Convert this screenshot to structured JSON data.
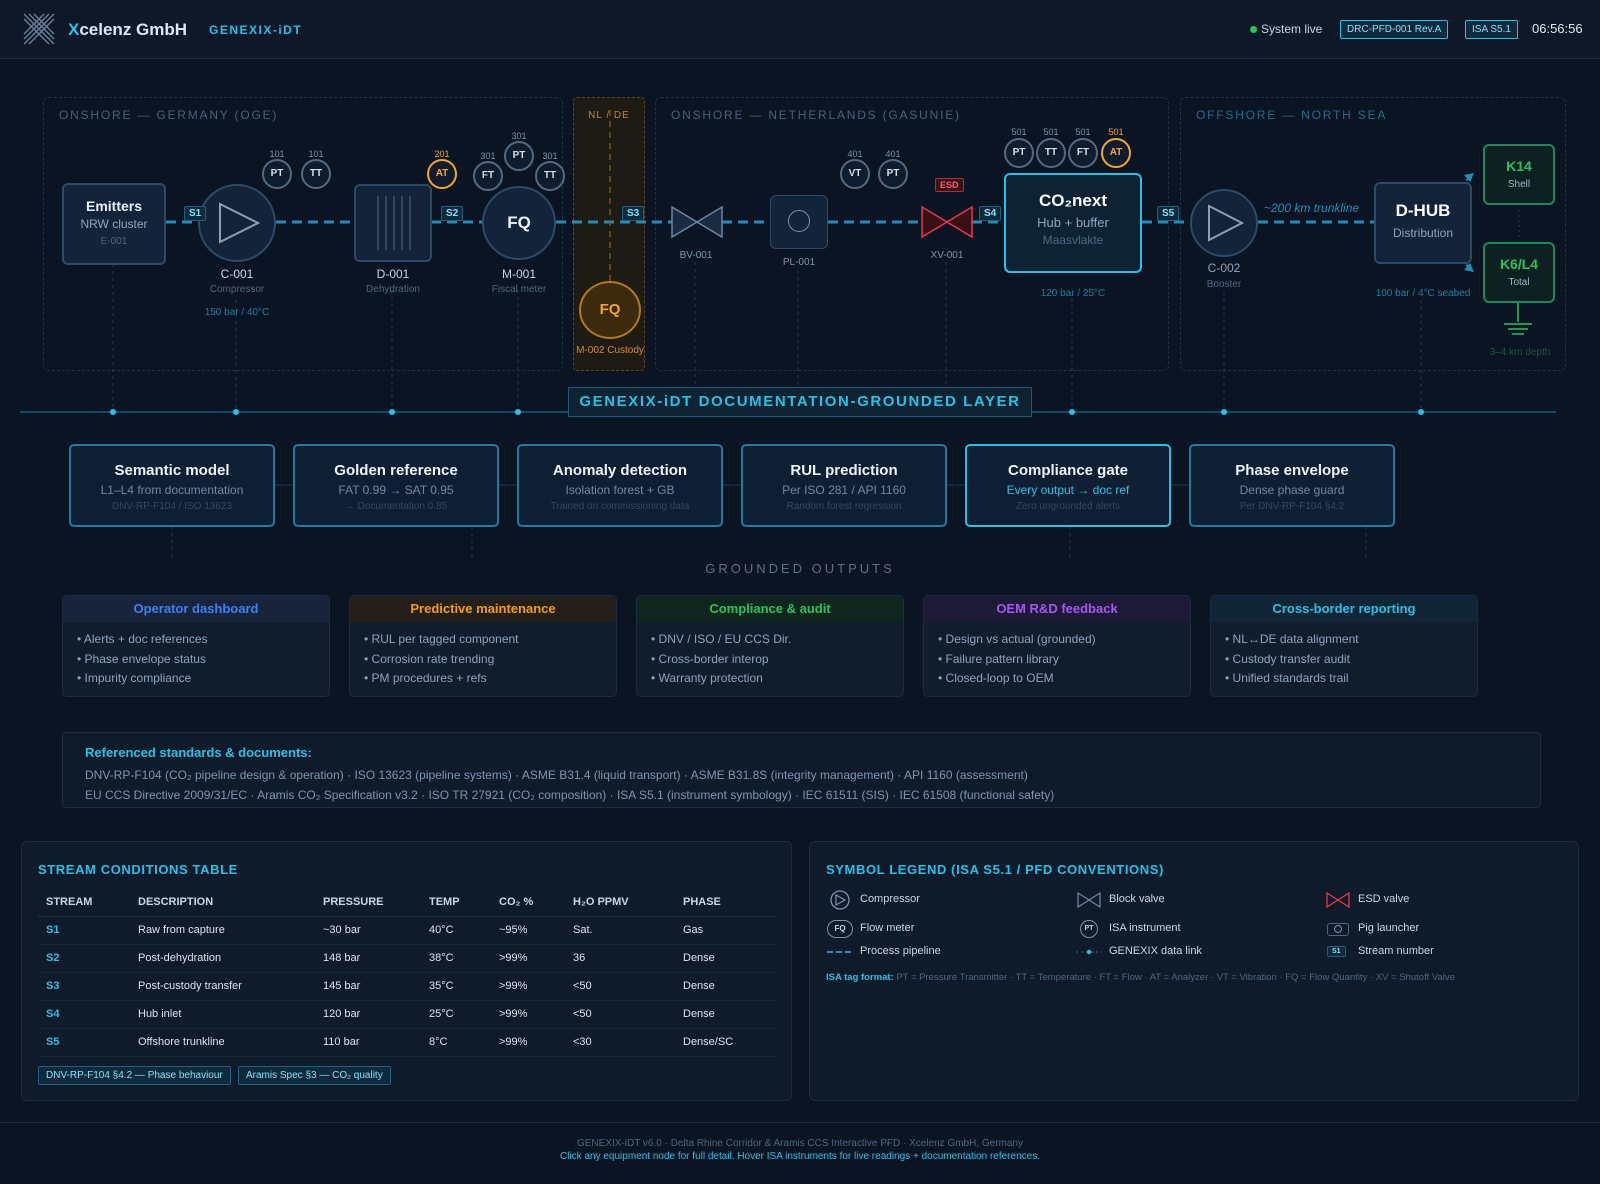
{
  "header": {
    "logo_icon": "xcelenz-logo-icon",
    "brand_x": "X",
    "brand_rest": "celenz GmbH",
    "app": "GENEXIX-iDT",
    "status": "System live",
    "doc_badge": "DRC-PFD-001 Rev.A",
    "isa_badge": "ISA S5.1",
    "time": "06:56:56"
  },
  "zones": {
    "germany": "ONSHORE — GERMANY (OGE)",
    "nlde": "NL / DE",
    "netherlands": "ONSHORE — NETHERLANDS (GASUNIE)",
    "offshore": "OFFSHORE — NORTH SEA"
  },
  "equipment": {
    "emitters": {
      "title": "Emitters",
      "sub": "NRW cluster",
      "tag": "E-001"
    },
    "c001": {
      "tag": "C-001",
      "sub": "Compressor",
      "cond": "150 bar / 40°C"
    },
    "d001": {
      "tag": "D-001",
      "sub": "Dehydration"
    },
    "m001": {
      "symbol": "FQ",
      "tag": "M-001",
      "sub": "Fiscal meter"
    },
    "m002": {
      "symbol": "FQ",
      "tag": "M-002 Custody"
    },
    "bv001": {
      "tag": "BV-001"
    },
    "pl001": {
      "tag": "PL-001"
    },
    "xv001": {
      "tag": "XV-001",
      "esd": "ESD"
    },
    "hub": {
      "title": "CO₂next",
      "sub": "Hub + buffer",
      "loc": "Maasvlakte",
      "cond": "120 bar / 25°C"
    },
    "c002": {
      "tag": "C-002",
      "sub": "Booster"
    },
    "trunkline": "~200 km trunkline",
    "dhub": {
      "title": "D-HUB",
      "sub": "Distribution",
      "cond": "100 bar / 4°C seabed"
    },
    "k14": {
      "title": "K14",
      "sub": "Shell"
    },
    "k6": {
      "title": "K6/L4",
      "sub": "Total"
    },
    "depth": "3–4 km depth"
  },
  "streams": [
    "S1",
    "S2",
    "S3",
    "S4",
    "S5"
  ],
  "instruments": [
    {
      "sym": "PT",
      "tag": "101"
    },
    {
      "sym": "TT",
      "tag": "101"
    },
    {
      "sym": "AT",
      "tag": "201"
    },
    {
      "sym": "FT",
      "tag": "301"
    },
    {
      "sym": "PT",
      "tag": "301"
    },
    {
      "sym": "TT",
      "tag": "301"
    },
    {
      "sym": "VT",
      "tag": "401"
    },
    {
      "sym": "PT",
      "tag": "401"
    },
    {
      "sym": "PT",
      "tag": "501"
    },
    {
      "sym": "TT",
      "tag": "501"
    },
    {
      "sym": "FT",
      "tag": "501"
    },
    {
      "sym": "AT",
      "tag": "501"
    }
  ],
  "layer_title": "GENEXIX-iDT DOCUMENTATION-GROUNDED LAYER",
  "modules": [
    {
      "title": "Semantic model",
      "sub": "L1–L4 from documentation",
      "ref": "DNV-RP-F104 / ISO 13623"
    },
    {
      "title": "Golden reference",
      "sub": "FAT 0.99 → SAT 0.95",
      "ref": "→ Documentation 0.85"
    },
    {
      "title": "Anomaly detection",
      "sub": "Isolation forest + GB",
      "ref": "Trained on commissioning data"
    },
    {
      "title": "RUL prediction",
      "sub": "Per ISO 281 / API 1160",
      "ref": "Random forest regression"
    },
    {
      "title": "Compliance gate",
      "sub": "Every output → doc ref",
      "ref": "Zero ungrounded alerts"
    },
    {
      "title": "Phase envelope",
      "sub": "Dense phase guard",
      "ref": "Per DNV-RP-F104 §4.2"
    }
  ],
  "outputs_title": "GROUNDED OUTPUTS",
  "outputs": [
    {
      "title": "Operator dashboard",
      "color": "#3b82f6",
      "items": [
        "• Alerts + doc references",
        "• Phase envelope status",
        "• Impurity compliance"
      ]
    },
    {
      "title": "Predictive maintenance",
      "color": "#f59e0b",
      "items": [
        "• RUL per tagged component",
        "• Corrosion rate trending",
        "• PM procedures + refs"
      ]
    },
    {
      "title": "Compliance & audit",
      "color": "#22c55e",
      "items": [
        "• DNV / ISO / EU CCS Dir.",
        "• Cross-border interop",
        "• Warranty protection"
      ]
    },
    {
      "title": "OEM R&D feedback",
      "color": "#a855f7",
      "items": [
        "• Design vs actual (grounded)",
        "• Failure pattern library",
        "• Closed-loop to OEM"
      ]
    },
    {
      "title": "Cross-border reporting",
      "color": "#22c3e6",
      "items": [
        "• NL↔DE data alignment",
        "• Custody transfer audit",
        "• Unified standards trail"
      ]
    }
  ],
  "standards": {
    "title": "Referenced standards & documents:",
    "line1": "DNV-RP-F104 (CO₂ pipeline design & operation) · ISO 13623 (pipeline systems) · ASME B31.4 (liquid transport) · ASME B31.8S (integrity management) · API 1160 (assessment)",
    "line2": "EU CCS Directive 2009/31/EC · Aramis CO₂ Specification v3.2 · ISO TR 27921 (CO₂ composition) · ISA S5.1 (instrument symbology) · IEC 61511 (SIS) · IEC 61508 (functional safety)"
  },
  "stream_table": {
    "title": "STREAM CONDITIONS TABLE",
    "headers": [
      "STREAM",
      "DESCRIPTION",
      "PRESSURE",
      "TEMP",
      "CO₂ %",
      "H₂O PPMV",
      "PHASE"
    ],
    "rows": [
      [
        "S1",
        "Raw from capture",
        "~30 bar",
        "40°C",
        "~95%",
        "Sat.",
        "Gas"
      ],
      [
        "S2",
        "Post-dehydration",
        "148 bar",
        "38°C",
        ">99%",
        "36",
        "Dense"
      ],
      [
        "S3",
        "Post-custody transfer",
        "145 bar",
        "35°C",
        ">99%",
        "<50",
        "Dense"
      ],
      [
        "S4",
        "Hub inlet",
        "120 bar",
        "25°C",
        ">99%",
        "<50",
        "Dense"
      ],
      [
        "S5",
        "Offshore trunkline",
        "110 bar",
        "8°C",
        ">99%",
        "<30",
        "Dense/SC"
      ]
    ],
    "refs": [
      "DNV-RP-F104 §4.2 — Phase behaviour",
      "Aramis Spec §3 — CO₂ quality"
    ]
  },
  "legend": {
    "title": "SYMBOL LEGEND (ISA S5.1 / PFD CONVENTIONS)",
    "items": [
      {
        "icon": "compressor-icon",
        "label": "Compressor"
      },
      {
        "icon": "block-valve-icon",
        "label": "Block valve"
      },
      {
        "icon": "esd-valve-icon",
        "label": "ESD valve"
      },
      {
        "icon": "flow-meter-icon",
        "label": "Flow meter",
        "sym": "FQ"
      },
      {
        "icon": "isa-instrument-icon",
        "label": "ISA instrument",
        "sym": "PT"
      },
      {
        "icon": "pig-launcher-icon",
        "label": "Pig launcher"
      },
      {
        "icon": "process-pipeline-icon",
        "label": "Process pipeline"
      },
      {
        "icon": "data-link-icon",
        "label": "GENEXIX data link"
      },
      {
        "icon": "stream-number-icon",
        "label": "Stream number",
        "sym": "S1"
      }
    ],
    "tag_format_label": "ISA tag format:",
    "tag_format": "PT = Pressure Transmitter · TT = Temperature · FT = Flow · AT = Analyzer · VT = Vibration · FQ = Flow Quantity · XV = Shutoff Valve"
  },
  "footer": {
    "line1": "GENEXIX-iDT v6.0 · Delta Rhine Corridor & Aramis CCS Interactive PFD · Xcelenz GmbH, Germany",
    "line2": "Click any equipment node for full detail. Hover ISA instruments for live readings + documentation references."
  },
  "colors": {
    "accent": "#22c3e6",
    "amber": "#f5a623",
    "esd": "#e23b4a",
    "green": "#22c55e"
  }
}
